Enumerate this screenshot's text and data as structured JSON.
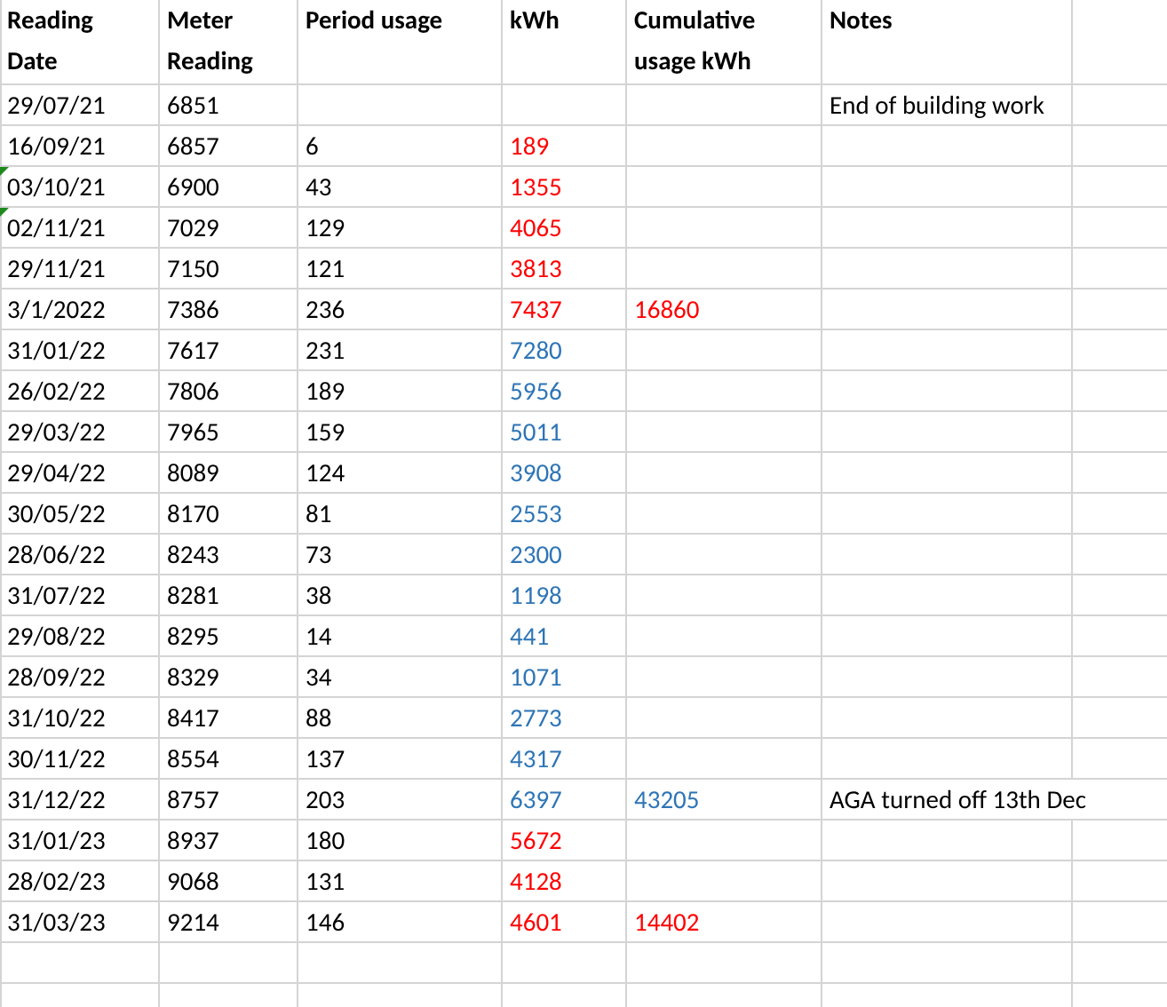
{
  "columns": [
    "Reading Date",
    "Meter Reading",
    "Period usage",
    "kWh",
    "Cumulative usage kWh",
    "Notes"
  ],
  "rows": [
    {
      "date": "29/07/21",
      "meter": "6851",
      "notes": "End of building work",
      "flag": false
    },
    {
      "date": "16/09/21",
      "meter": "6857",
      "period": "6",
      "kwh": {
        "text": "189",
        "color": "#ff0000"
      },
      "flag": false
    },
    {
      "date": "03/10/21",
      "meter": "6900",
      "period": "43",
      "kwh": {
        "text": "1355",
        "color": "#ff0000"
      },
      "flag": true
    },
    {
      "date": "02/11/21",
      "meter": "7029",
      "period": "129",
      "kwh": {
        "text": "4065",
        "color": "#ff0000"
      },
      "flag": true
    },
    {
      "date": "29/11/21",
      "meter": "7150",
      "period": "121",
      "kwh": {
        "text": "3813",
        "color": "#ff0000"
      },
      "flag": false
    },
    {
      "date": "3/1/2022",
      "meter": "7386",
      "period": "236",
      "kwh": {
        "text": "7437",
        "color": "#ff0000"
      },
      "cumulative": {
        "text": "16860",
        "color": "#ff0000"
      },
      "flag": false
    },
    {
      "date": "31/01/22",
      "meter": "7617",
      "period": "231",
      "kwh": {
        "text": "7280",
        "color": "#2e75b6"
      },
      "flag": false
    },
    {
      "date": "26/02/22",
      "meter": "7806",
      "period": "189",
      "kwh": {
        "text": "5956",
        "color": "#2e75b6"
      },
      "flag": false
    },
    {
      "date": "29/03/22",
      "meter": "7965",
      "period": "159",
      "kwh": {
        "text": "5011",
        "color": "#2e75b6"
      },
      "flag": false
    },
    {
      "date": "29/04/22",
      "meter": "8089",
      "period": "124",
      "kwh": {
        "text": "3908",
        "color": "#2e75b6"
      },
      "flag": false
    },
    {
      "date": "30/05/22",
      "meter": "8170",
      "period": "81",
      "kwh": {
        "text": "2553",
        "color": "#2e75b6"
      },
      "flag": false
    },
    {
      "date": "28/06/22",
      "meter": "8243",
      "period": "73",
      "kwh": {
        "text": "2300",
        "color": "#2e75b6"
      },
      "flag": false
    },
    {
      "date": "31/07/22",
      "meter": "8281",
      "period": "38",
      "kwh": {
        "text": "1198",
        "color": "#2e75b6"
      },
      "flag": false
    },
    {
      "date": "29/08/22",
      "meter": "8295",
      "period": "14",
      "kwh": {
        "text": "441",
        "color": "#2e75b6"
      },
      "flag": false
    },
    {
      "date": "28/09/22",
      "meter": "8329",
      "period": "34",
      "kwh": {
        "text": "1071",
        "color": "#2e75b6"
      },
      "flag": false
    },
    {
      "date": "31/10/22",
      "meter": "8417",
      "period": "88",
      "kwh": {
        "text": "2773",
        "color": "#2e75b6"
      },
      "flag": false
    },
    {
      "date": "30/11/22",
      "meter": "8554",
      "period": "137",
      "kwh": {
        "text": "4317",
        "color": "#2e75b6"
      },
      "flag": false
    },
    {
      "date": "31/12/22",
      "meter": "8757",
      "period": "203",
      "kwh": {
        "text": "6397",
        "color": "#2e75b6"
      },
      "cumulative": {
        "text": "43205",
        "color": "#2e75b6"
      },
      "notes": "AGA turned off 13th Dec",
      "flag": false
    },
    {
      "date": "31/01/23",
      "meter": "8937",
      "period": "180",
      "kwh": {
        "text": "5672",
        "color": "#ff0000"
      },
      "flag": false
    },
    {
      "date": "28/02/23",
      "meter": "9068",
      "period": "131",
      "kwh": {
        "text": "4128",
        "color": "#ff0000"
      },
      "flag": false
    },
    {
      "date": "31/03/23",
      "meter": "9214",
      "period": "146",
      "kwh": {
        "text": "4601",
        "color": "#ff0000"
      },
      "cumulative": {
        "text": "14402",
        "color": "#ff0000"
      },
      "flag": false
    }
  ]
}
